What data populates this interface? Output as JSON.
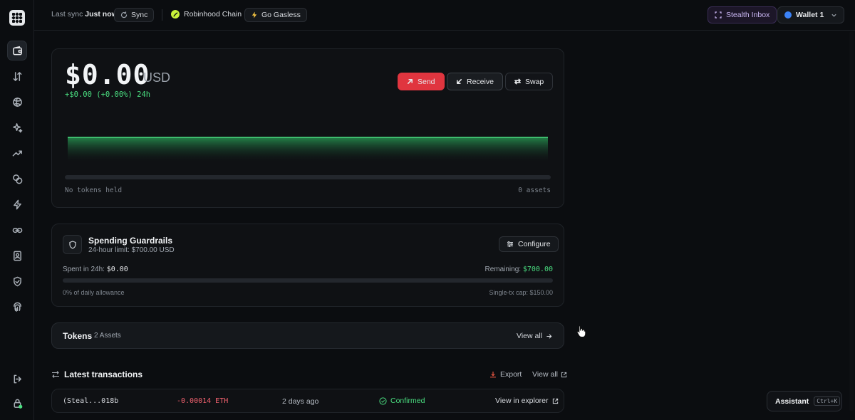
{
  "topbar": {
    "last_sync_label": "Last sync",
    "last_sync_value": "Just now",
    "sync_button": "Sync",
    "chain": "Robinhood Chain",
    "gasless": "Go Gasless",
    "stealth_inbox": "Stealth Inbox",
    "wallet": "Wallet 1"
  },
  "sidebar": {
    "icons": [
      "wallet-icon",
      "transfer-icon",
      "globe-icon",
      "sparkles-icon",
      "trending-icon",
      "coins-icon",
      "zap-icon",
      "link-icon",
      "contacts-icon",
      "shield-check-icon",
      "fingerprint-icon"
    ],
    "bottom_icons": [
      "logout-icon",
      "lock-icon"
    ]
  },
  "balance": {
    "amount": "$0.00",
    "currency": "USD",
    "change": "+$0.00 (+0.00%) 24h",
    "send": "Send",
    "receive": "Receive",
    "swap": "Swap",
    "no_tokens": "No tokens held",
    "assets": "0 assets"
  },
  "guardrails": {
    "title": "Spending Guardrails",
    "subtitle": "24-hour limit: $700.00 USD",
    "configure": "Configure",
    "spent_label": "Spent in 24h:",
    "spent_value": "$0.00",
    "remaining_label": "Remaining:",
    "remaining_value": "$700.00",
    "allowance": "0% of daily allowance",
    "cap": "Single-tx cap: $150.00",
    "allowance_used_fraction": 0
  },
  "tokens": {
    "title": "Tokens",
    "count": "2 Assets",
    "view_all": "View all"
  },
  "transactions": {
    "title": "Latest transactions",
    "export": "Export",
    "view_all": "View all",
    "rows": [
      {
        "address": "(Steal...018b",
        "amount": "-0.00014 ETH",
        "time": "2 days ago",
        "status": "Confirmed",
        "explorer": "View in explorer"
      }
    ]
  },
  "assistant": {
    "label": "Assistant",
    "shortcut": "Ctrl+K"
  },
  "colors": {
    "accent_red": "#e0353f",
    "positive_green": "#4ade80",
    "negative_red": "#f0616e",
    "background": "#0b0d10"
  }
}
